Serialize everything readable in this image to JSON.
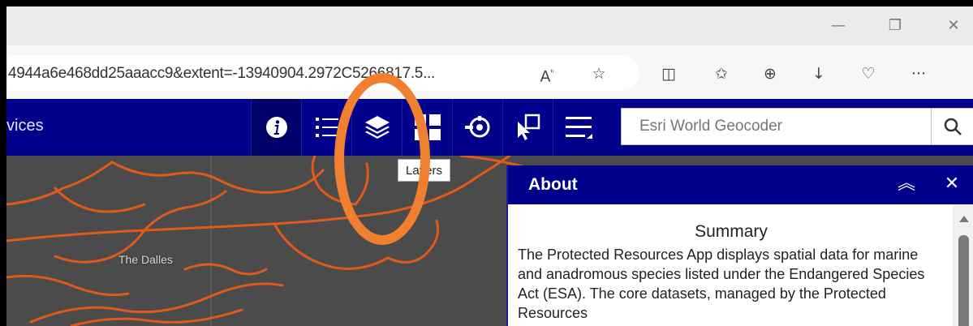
{
  "browser": {
    "url": "4944a6e468dd25aaacc9&extent=-13940904.2972C5266817.5...",
    "window_controls": [
      "minimize",
      "maximize",
      "close"
    ]
  },
  "app": {
    "title_partial": "vices",
    "tools": [
      {
        "name": "info",
        "icon": "info-icon",
        "active": true
      },
      {
        "name": "legend",
        "icon": "legend-list-icon"
      },
      {
        "name": "layers",
        "icon": "layers-icon"
      },
      {
        "name": "basemap",
        "icon": "basemap-grid-icon"
      },
      {
        "name": "analysis",
        "icon": "analysis-icon"
      },
      {
        "name": "select",
        "icon": "select-cursor-icon"
      },
      {
        "name": "menu",
        "icon": "menu-lines-icon"
      }
    ],
    "geocoder": {
      "placeholder": "Esri World Geocoder"
    }
  },
  "tooltip": {
    "text": "Layers"
  },
  "map": {
    "place_label": "The Dalles",
    "line_color": "#e05a1a"
  },
  "about_panel": {
    "title": "About",
    "summary_title": "Summary",
    "summary_text": "The Protected Resources App displays spatial data for marine and anadromous species listed under the Endangered Species Act (ESA). The core datasets, managed by the Protected Resources"
  },
  "highlight_color": "#f07f30"
}
